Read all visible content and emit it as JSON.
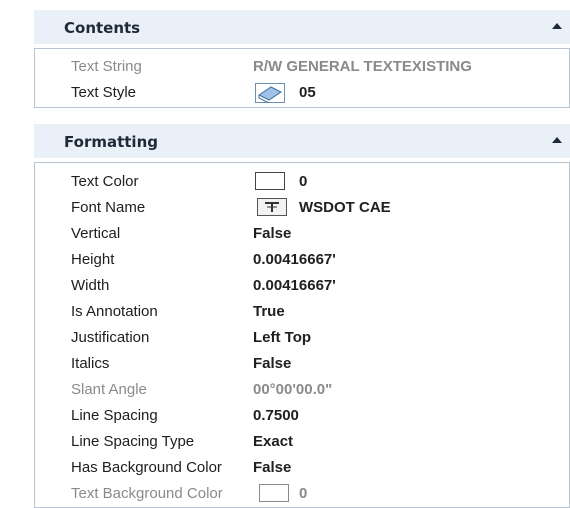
{
  "contents": {
    "title": "Contents",
    "rows": [
      {
        "label": "Text String",
        "value": "R/W GENERAL TEXTEXISTING"
      },
      {
        "label": "Text Style",
        "value": "05",
        "icon": "text-style-icon"
      }
    ]
  },
  "formatting": {
    "title": "Formatting",
    "rows": [
      {
        "label": "Text Color",
        "value": "0",
        "icon": "color-swatch"
      },
      {
        "label": "Font Name",
        "value": "WSDOT CAE",
        "icon": "font-icon"
      },
      {
        "label": "Vertical",
        "value": "False"
      },
      {
        "label": "Height",
        "value": "0.00416667'"
      },
      {
        "label": "Width",
        "value": "0.00416667'"
      },
      {
        "label": "Is Annotation",
        "value": "True"
      },
      {
        "label": "Justification",
        "value": "Left Top"
      },
      {
        "label": "Italics",
        "value": "False"
      },
      {
        "label": "Slant Angle",
        "value": "00°00'00.0\""
      },
      {
        "label": "Line Spacing",
        "value": "0.7500"
      },
      {
        "label": "Line Spacing Type",
        "value": "Exact"
      },
      {
        "label": "Has Background Color",
        "value": "False"
      },
      {
        "label": "Text Background Color",
        "value": "0",
        "icon": "color-swatch"
      }
    ]
  },
  "colors": {
    "header_bg": "#e9f0f8",
    "border": "#b8c4d2",
    "disabled_text": "#8a8a8a"
  },
  "icons": {
    "collapse": "chevron-up-icon"
  }
}
